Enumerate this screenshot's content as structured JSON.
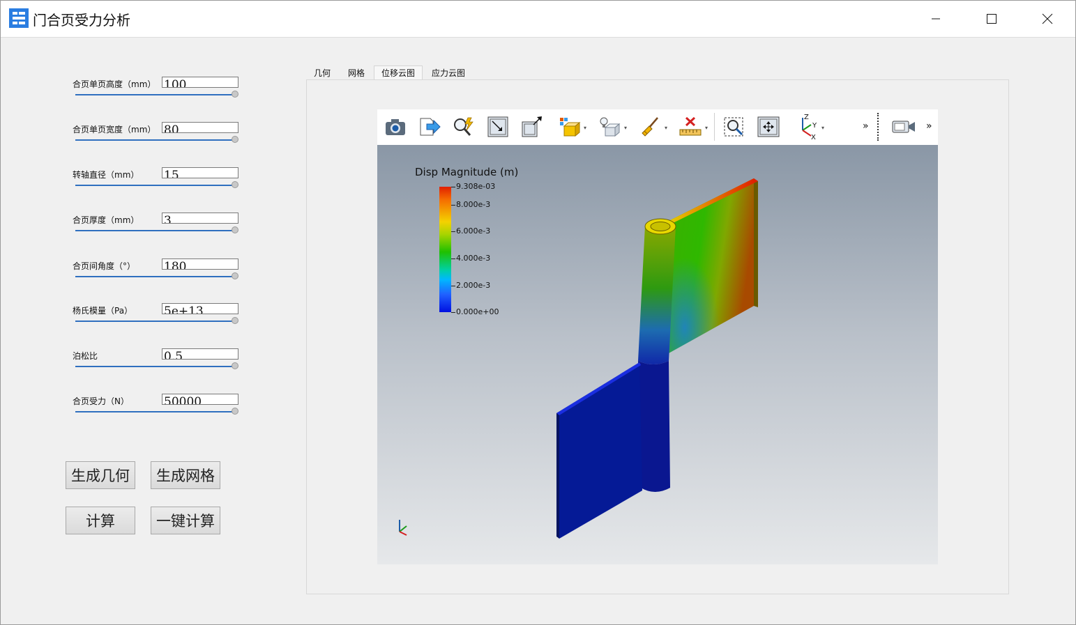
{
  "window": {
    "title": "门合页受力分析"
  },
  "params": [
    {
      "label": "合页单页高度（mm）",
      "value": "100"
    },
    {
      "label": "合页单页宽度（mm）",
      "value": "80"
    },
    {
      "label": "转轴直径（mm）",
      "value": "15"
    },
    {
      "label": "合页厚度（mm）",
      "value": "3"
    },
    {
      "label": "合页间角度（°）",
      "value": "180"
    },
    {
      "label": "杨氏模量（Pa）",
      "value": "5e+13"
    },
    {
      "label": "泊松比",
      "value": "0.5"
    },
    {
      "label": "合页受力（N）",
      "value": "50000"
    }
  ],
  "buttons": {
    "gen_geometry": "生成几何",
    "gen_mesh": "生成网格",
    "compute": "计算",
    "one_click": "一键计算"
  },
  "tabs": [
    {
      "label": "几何",
      "active": false
    },
    {
      "label": "网格",
      "active": false
    },
    {
      "label": "位移云图",
      "active": true
    },
    {
      "label": "应力云图",
      "active": false
    }
  ],
  "viewer": {
    "toolbar_icons": [
      "camera-icon",
      "export-icon",
      "query-icon",
      "reset-camera-icon",
      "zoom-to-data-icon",
      "representation-icon",
      "light-icon",
      "clear-icon",
      "ruler-icon",
      "zoom-box-icon",
      "pan-icon",
      "axes-icon",
      "more-icon",
      "video-icon",
      "more-icon-2"
    ],
    "more_glyph": "»",
    "axis_labels": {
      "z": "Z",
      "y": "Y",
      "x": "X"
    },
    "legend": {
      "title": "Disp Magnitude (m)",
      "ticks": [
        "9.308e-03",
        "8.000e-3",
        "6.000e-3",
        "4.000e-3",
        "2.000e-3",
        "0.000e+00"
      ],
      "max": 0.009308,
      "min": 0.0
    },
    "colors": {
      "accent": "#2f6fbf",
      "high": "#e11f00",
      "low": "#0010e0"
    }
  }
}
